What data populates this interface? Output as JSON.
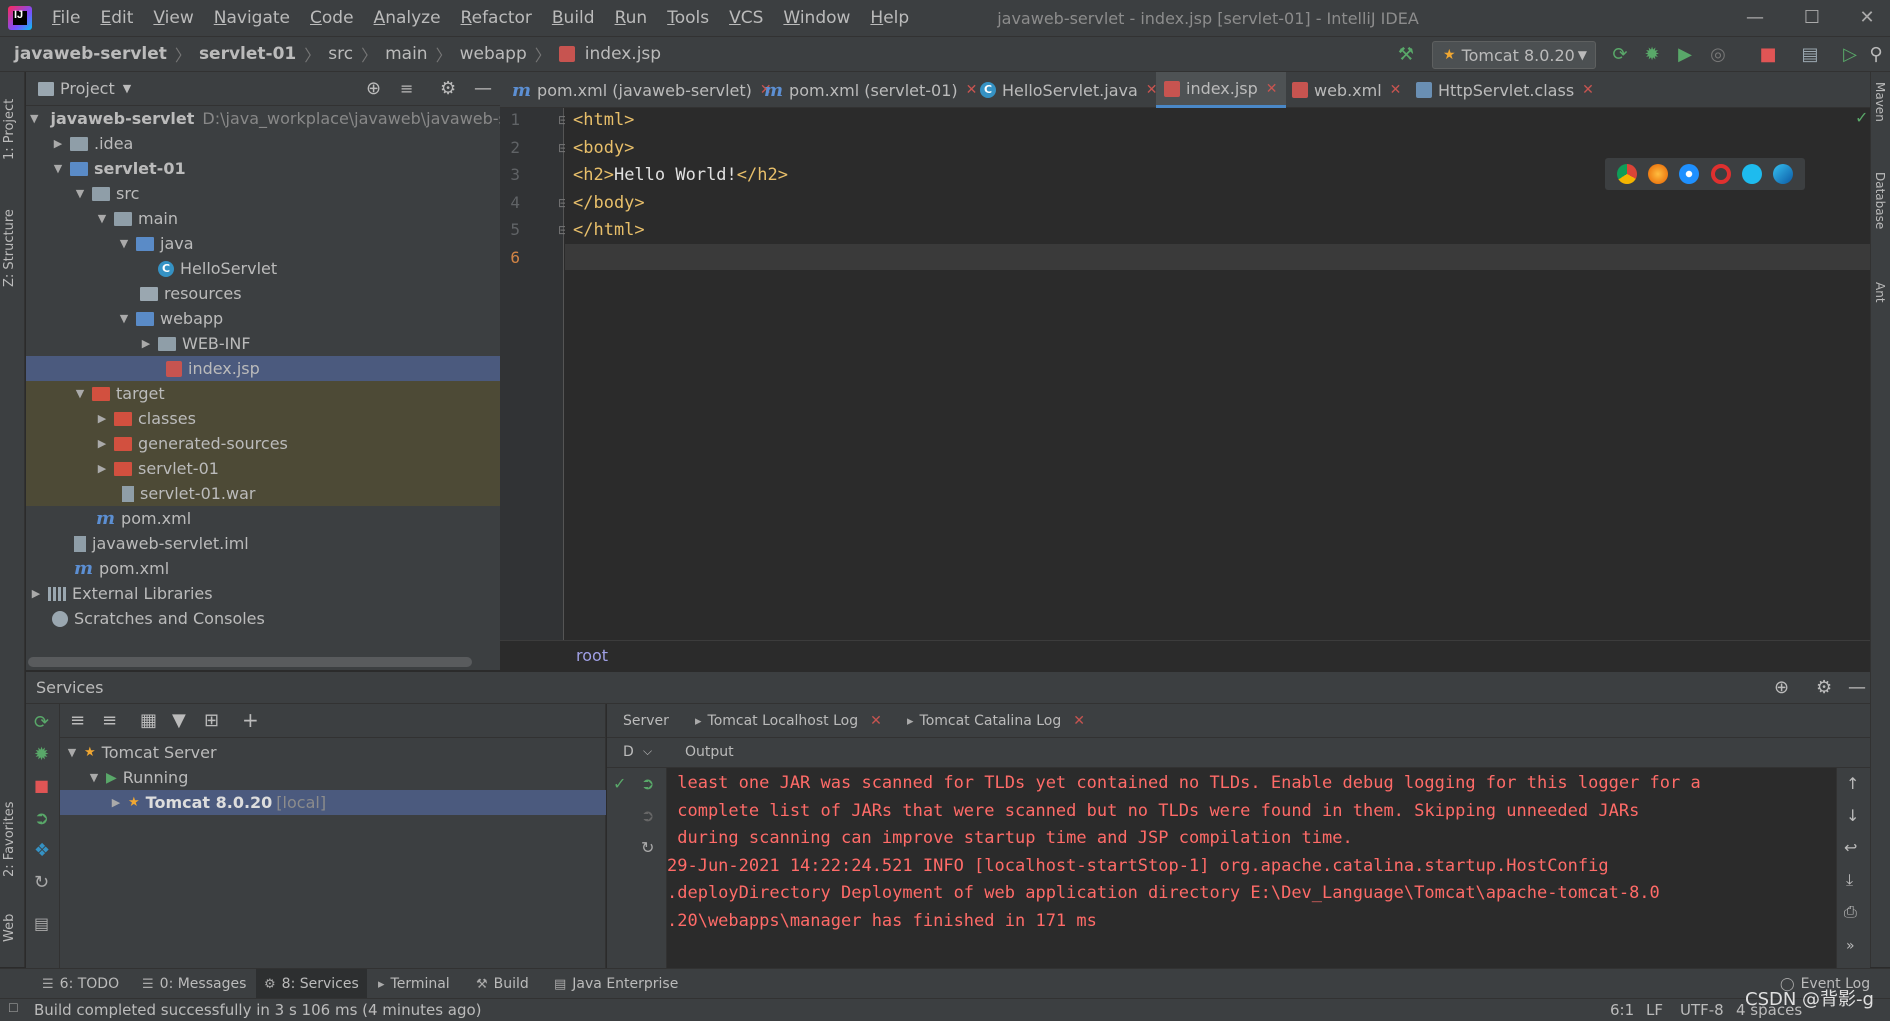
{
  "menubar": {
    "items": [
      "File",
      "Edit",
      "View",
      "Navigate",
      "Code",
      "Analyze",
      "Refactor",
      "Build",
      "Run",
      "Tools",
      "VCS",
      "Window",
      "Help"
    ],
    "window_title": "javaweb-servlet - index.jsp [servlet-01] - IntelliJ IDEA"
  },
  "navbar": {
    "crumbs": [
      "javaweb-servlet",
      "servlet-01",
      "src",
      "main",
      "webapp",
      "index.jsp"
    ],
    "run_config": "Tomcat 8.0.20"
  },
  "left_strip": {
    "project_tab": "1: Project",
    "structure_tab": "Z: Structure",
    "favorites_tab": "2: Favorites",
    "web_tab": "Web"
  },
  "right_strip": {
    "maven_tab": "Maven",
    "database_tab": "Database",
    "ant_tab": "Ant"
  },
  "project": {
    "header_label": "Project",
    "rows": [
      {
        "label": "javaweb-servlet",
        "extra": "D:\\java_workplace\\javaweb\\javaweb-serv"
      },
      {
        "label": ".idea"
      },
      {
        "label": "servlet-01"
      },
      {
        "label": "src"
      },
      {
        "label": "main"
      },
      {
        "label": "java"
      },
      {
        "label": "HelloServlet"
      },
      {
        "label": "resources"
      },
      {
        "label": "webapp"
      },
      {
        "label": "WEB-INF"
      },
      {
        "label": "index.jsp"
      },
      {
        "label": "target"
      },
      {
        "label": "classes"
      },
      {
        "label": "generated-sources"
      },
      {
        "label": "servlet-01"
      },
      {
        "label": "servlet-01.war"
      },
      {
        "label": "pom.xml"
      },
      {
        "label": "javaweb-servlet.iml"
      },
      {
        "label": "pom.xml"
      },
      {
        "label": "External Libraries"
      },
      {
        "label": "Scratches and Consoles"
      }
    ]
  },
  "editor": {
    "tabs": [
      "pom.xml (javaweb-servlet)",
      "pom.xml (servlet-01)",
      "HelloServlet.java",
      "index.jsp",
      "web.xml",
      "HttpServlet.class"
    ],
    "line_numbers": [
      "1",
      "2",
      "3",
      "4",
      "5",
      "6"
    ],
    "lines": {
      "l1": "<html>",
      "l2": "<body>",
      "l3_open": "<h2>",
      "l3_text": "Hello World!",
      "l3_close": "</h2>",
      "l4": "</body>",
      "l5": "</html>"
    },
    "breadcrumb": "root"
  },
  "services": {
    "title": "Services",
    "tree": {
      "server": "Tomcat Server",
      "status": "Running",
      "instance": "Tomcat 8.0.20",
      "instance_tag": "[local]"
    },
    "log_tabs": [
      "Server",
      "Tomcat Localhost Log",
      "Tomcat Catalina Log"
    ],
    "deploy_label": "D",
    "output_label": "Output",
    "log_lines": [
      " least one JAR was scanned for TLDs yet contained no TLDs. Enable debug logging for this logger for a",
      " complete list of JARs that were scanned but no TLDs were found in them. Skipping unneeded JARs",
      " during scanning can improve startup time and JSP compilation time.",
      "29-Jun-2021 14:22:24.521 INFO [localhost-startStop-1] org.apache.catalina.startup.HostConfig",
      ".deployDirectory Deployment of web application directory E:\\Dev_Language\\Tomcat\\apache-tomcat-8.0",
      ".20\\webapps\\manager has finished in 171 ms"
    ]
  },
  "tool_tabs": [
    "6: TODO",
    "0: Messages",
    "8: Services",
    "Terminal",
    "Build",
    "Java Enterprise",
    "Event Log"
  ],
  "status": {
    "message": "Build completed successfully in 3 s 106 ms (4 minutes ago)",
    "position": "6:1",
    "line_sep": "LF",
    "encoding": "UTF-8",
    "indent": "4 spaces",
    "watermark": "CSDN @背影-g"
  },
  "colors": {
    "selection": "#4b5a7e",
    "excluded": "#4d4a36",
    "log_red": "#ff6b68",
    "tag": "#e8bf6a"
  }
}
